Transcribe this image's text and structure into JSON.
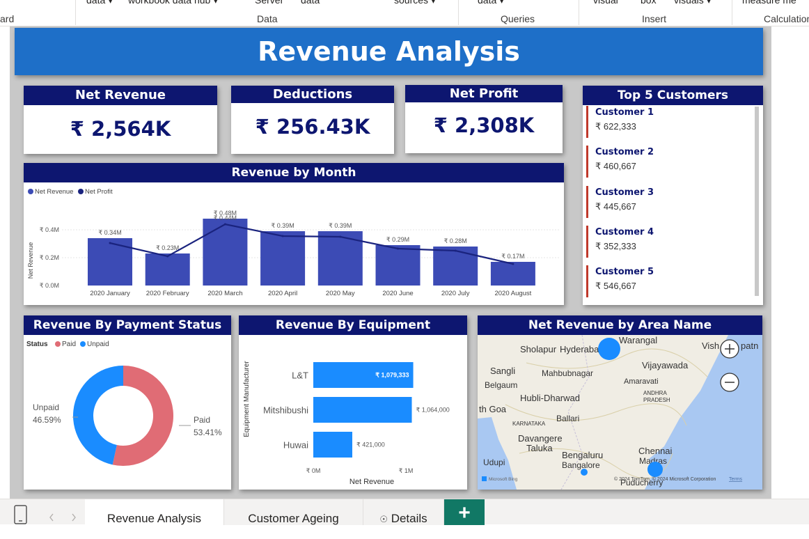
{
  "ribbon": {
    "top_items": [
      {
        "label": "data ▾",
        "x": 124
      },
      {
        "label": "workbook data hub ▾",
        "x": 184
      },
      {
        "label": "Server",
        "x": 366
      },
      {
        "label": "data",
        "x": 432
      },
      {
        "label": "sources ▾",
        "x": 566
      },
      {
        "label": "data ▾",
        "x": 686
      },
      {
        "label": "visual",
        "x": 852
      },
      {
        "label": "box",
        "x": 920
      },
      {
        "label": "visuals ▾",
        "x": 968
      },
      {
        "label": "measure me",
        "x": 1066
      }
    ],
    "groups": [
      {
        "label": "ard"
      },
      {
        "label": "Data"
      },
      {
        "label": "Queries"
      },
      {
        "label": "Insert"
      },
      {
        "label": "Calculation"
      }
    ]
  },
  "report": {
    "title": "Revenue Analysis",
    "kpis": [
      {
        "title": "Net Revenue",
        "value": "₹ 2,564K"
      },
      {
        "title": "Deductions",
        "value": "₹ 256.43K"
      },
      {
        "title": "Net Profit",
        "value": "₹ 2,308K"
      }
    ],
    "top_customers": {
      "title": "Top 5 Customers",
      "items": [
        {
          "name": "Customer 1",
          "value": "₹ 622,333"
        },
        {
          "name": "Customer 2",
          "value": "₹ 460,667"
        },
        {
          "name": "Customer 3",
          "value": "₹ 445,667"
        },
        {
          "name": "Customer 4",
          "value": "₹ 352,333"
        },
        {
          "name": "Customer 5",
          "value": "₹ 546,667"
        }
      ]
    },
    "revenue_by_month": {
      "title": "Revenue by Month",
      "legend": [
        "Net Revenue",
        "Net Profit"
      ],
      "ylabel": "Net Revenue",
      "yticks": [
        "₹ 0.0M",
        "₹ 0.2M",
        "₹ 0.4M"
      ]
    },
    "payment_status": {
      "title": "Revenue By Payment Status",
      "legend_title": "Status",
      "legend": [
        "Paid",
        "Unpaid"
      ],
      "labels": [
        {
          "name": "Unpaid",
          "pct": "46.59%"
        },
        {
          "name": "Paid",
          "pct": "53.41%"
        }
      ]
    },
    "equipment": {
      "title": "Revenue By Equipment",
      "ylabel": "Equipment Manufacturer",
      "xlabel": "Net Revenue",
      "xticks": [
        "₹ 0M",
        "₹ 1M"
      ]
    },
    "map": {
      "title": "Net Revenue by Area Name",
      "places": [
        "Warangal",
        "Sholapur",
        "Hyderabad",
        "Vish",
        "patn",
        "Sangli",
        "Mahbubnagar",
        "Vijayawada",
        "Belgaum",
        "Amaravati",
        "ANDHRA",
        "PRADESH",
        "Hubli-Dharwad",
        "th Goa",
        "Ballari",
        "KARNATAKA",
        "Davangere",
        "Taluka",
        "Bengaluru",
        "Bangalore",
        "Chennai",
        "Madras",
        "Udupi",
        "Puducherry"
      ],
      "attribution": "© 2024 TomTom, © 2024 Microsoft Corporation",
      "terms": "Terms",
      "brand": "Microsoft Bing"
    }
  },
  "tabs": [
    {
      "label": "Revenue Analysis",
      "active": true
    },
    {
      "label": "Customer Ageing",
      "active": false
    },
    {
      "label": "Details",
      "active": false
    }
  ],
  "chart_data": [
    {
      "type": "bar",
      "title": "Revenue by Month",
      "categories": [
        "2020 January",
        "2020 February",
        "2020 March",
        "2020 April",
        "2020 May",
        "2020 June",
        "2020 July",
        "2020 August"
      ],
      "series": [
        {
          "name": "Net Revenue",
          "values": [
            0.34,
            0.23,
            0.48,
            0.39,
            0.39,
            0.29,
            0.28,
            0.17
          ],
          "labels": [
            "₹ 0.34M",
            "₹ 0.23M",
            "₹ 0.48M",
            "₹ 0.39M",
            "₹ 0.39M",
            "₹ 0.29M",
            "₹ 0.28M",
            "₹ 0.17M"
          ]
        },
        {
          "name": "Net Profit",
          "type": "line",
          "values": [
            0.305,
            0.21,
            0.44,
            0.355,
            0.35,
            0.265,
            0.25,
            0.155
          ],
          "labels": [
            "",
            "",
            "₹ 0.44M",
            "",
            "",
            "",
            "",
            ""
          ]
        }
      ],
      "ylabel": "Net Revenue",
      "ylim": [
        0,
        0.48
      ],
      "legend": "top-left"
    },
    {
      "type": "pie",
      "title": "Revenue By Payment Status",
      "categories": [
        "Paid",
        "Unpaid"
      ],
      "values": [
        53.41,
        46.59
      ],
      "colors": [
        "#e06c75",
        "#1a8cff"
      ],
      "legend": "top-left"
    },
    {
      "type": "bar",
      "orientation": "horizontal",
      "title": "Revenue By Equipment",
      "categories": [
        "L&T",
        "Mitshibushi",
        "Huwai"
      ],
      "values": [
        1079333,
        1064000,
        421000
      ],
      "labels": [
        "₹ 1,079,333",
        "₹ 1,064,000",
        "₹ 421,000"
      ],
      "xlabel": "Net Revenue",
      "ylabel": "Equipment Manufacturer",
      "xlim": [
        0,
        1100000
      ]
    }
  ],
  "colors": {
    "header": "#0d1670",
    "banner": "#1e6fc8",
    "bar": "#3c4bb5",
    "line": "#1a237e",
    "paid": "#e06c75",
    "unpaid": "#1a8cff",
    "equip": "#1a8cff",
    "customer_accent": "#c0392b"
  }
}
